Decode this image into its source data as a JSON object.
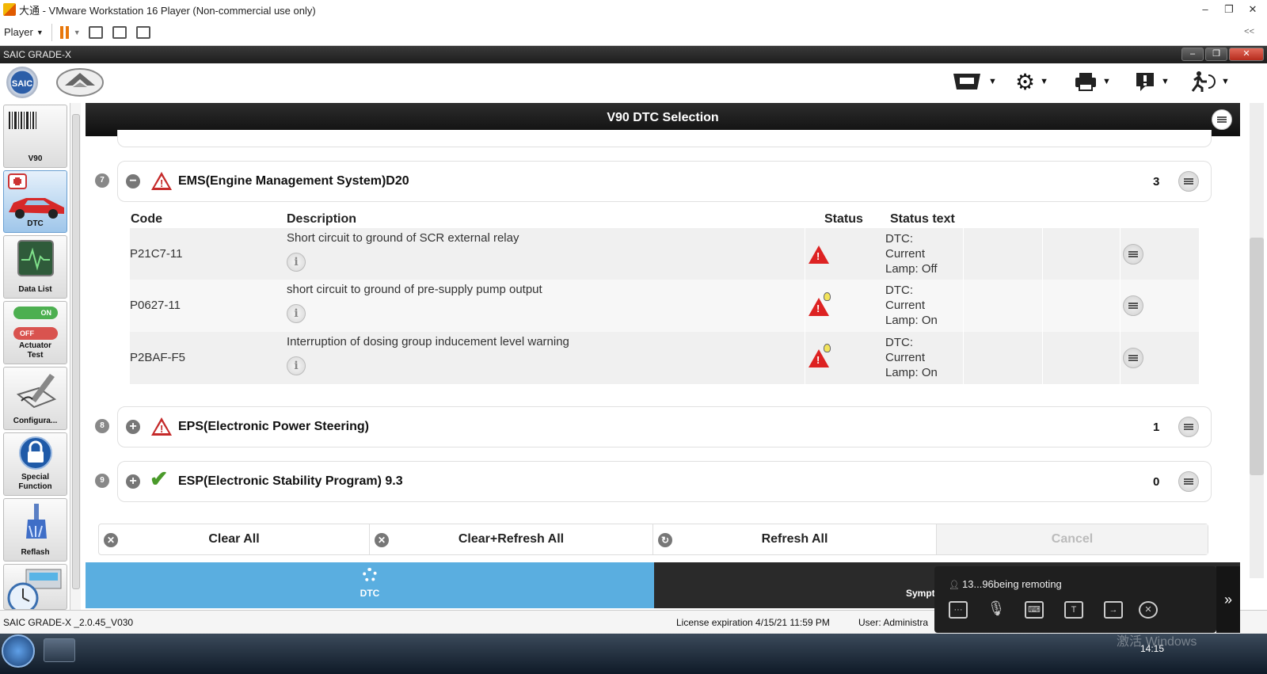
{
  "vm": {
    "title": "大通 - VMware Workstation 16 Player (Non-commercial use only)",
    "player_menu": "Player",
    "collapse_glyph": "<<"
  },
  "app": {
    "window_title": "SAIC GRADE-X",
    "logo_text": "SAIC",
    "page_title": "V90 DTC Selection"
  },
  "sidebar": {
    "items": [
      {
        "label": "V90",
        "icon": "barcode-icon"
      },
      {
        "label": "DTC",
        "icon": "car-medkit-icon"
      },
      {
        "label": "Data List",
        "icon": "monitor-pulse-icon"
      },
      {
        "label": "Actuator Test",
        "icon": "toggle-switch-icon",
        "on": "ON",
        "off": "OFF"
      },
      {
        "label": "Configura...",
        "icon": "pen-tablet-icon"
      },
      {
        "label": "Special Function",
        "icon": "lock-icon"
      },
      {
        "label": "Reflash",
        "icon": "brush-icon"
      },
      {
        "label": "",
        "icon": "printer-clock-icon"
      }
    ]
  },
  "table": {
    "headers": {
      "code": "Code",
      "description": "Description",
      "status": "Status",
      "status_text": "Status text"
    }
  },
  "groups": [
    {
      "num": "7",
      "expanded": true,
      "title": "EMS(Engine Management System)D20",
      "count": "3",
      "status_icon": "warning-icon",
      "rows": [
        {
          "code": "P21C7-11",
          "description": "Short circuit to ground of SCR external relay",
          "status_text": "DTC:\nCurrent\nLamp: Off",
          "lamp": false
        },
        {
          "code": "P0627-11",
          "description": "short circuit to ground of pre-supply pump output",
          "status_text": "DTC:\nCurrent\nLamp: On",
          "lamp": true
        },
        {
          "code": "P2BAF-F5",
          "description": "Interruption of dosing group inducement level warning",
          "status_text": "DTC:\nCurrent\nLamp: On",
          "lamp": true
        }
      ]
    },
    {
      "num": "8",
      "expanded": false,
      "title": "EPS(Electronic Power Steering)",
      "count": "1",
      "status_icon": "warning-icon"
    },
    {
      "num": "9",
      "expanded": false,
      "title": "ESP(Electronic Stability Program) 9.3",
      "count": "0",
      "status_icon": "checkmark-icon"
    }
  ],
  "actions": {
    "clear_all": "Clear All",
    "clear_refresh_all": "Clear+Refresh All",
    "refresh_all": "Refresh All",
    "cancel": "Cancel"
  },
  "tabs": {
    "dtc": "DTC",
    "symptom": "Sympt"
  },
  "statusbar": {
    "version": "SAIC GRADE-X _2.0.45_V030",
    "license": "License expiration 4/15/21 11:59 PM",
    "user": "User: Administra"
  },
  "remote": {
    "message": "13...96being remoting",
    "expand_glyph": "»"
  },
  "taskbar": {
    "time": "14:15",
    "watermark": "激活 Windows"
  },
  "colors": {
    "accent_blue": "#5aaee0",
    "warning_red": "#d22222",
    "ok_green": "#4a9a2a"
  }
}
